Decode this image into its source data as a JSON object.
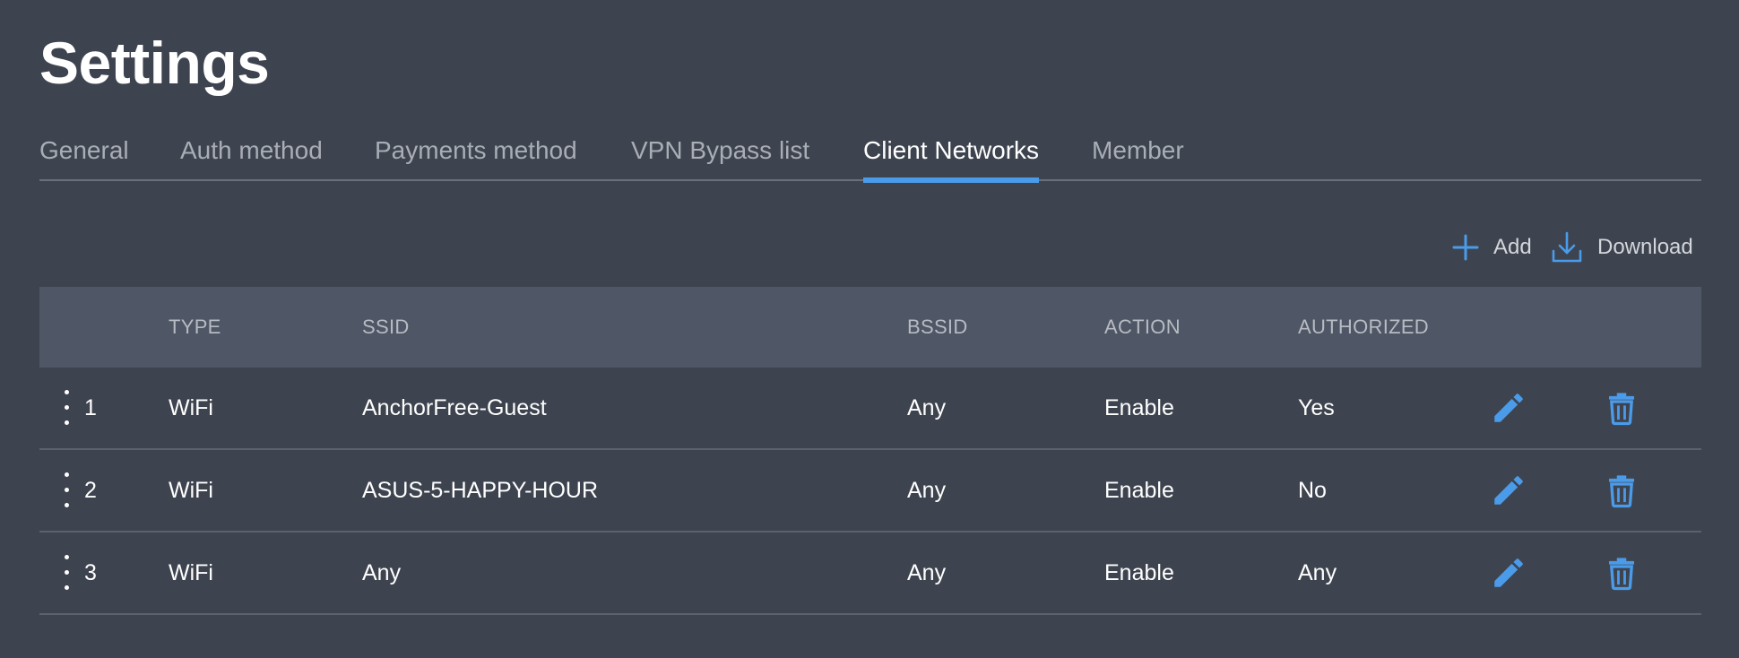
{
  "page": {
    "title": "Settings"
  },
  "tabs": [
    {
      "label": "General",
      "active": false
    },
    {
      "label": "Auth method",
      "active": false
    },
    {
      "label": "Payments method",
      "active": false
    },
    {
      "label": "VPN Bypass list",
      "active": false
    },
    {
      "label": "Client Networks",
      "active": true
    },
    {
      "label": "Member",
      "active": false
    }
  ],
  "toolbar": {
    "add_label": "Add",
    "add_icon": "plus-icon",
    "download_label": "Download",
    "download_icon": "download-icon"
  },
  "table": {
    "headers": {
      "type": "TYPE",
      "ssid": "SSID",
      "bssid": "BSSID",
      "action": "ACTION",
      "authorized": "AUTHORIZED"
    },
    "rows": [
      {
        "index": "1",
        "type": "WiFi",
        "ssid": "AnchorFree-Guest",
        "bssid": "Any",
        "action": "Enable",
        "authorized": "Yes"
      },
      {
        "index": "2",
        "type": "WiFi",
        "ssid": "ASUS-5-HAPPY-HOUR",
        "bssid": "Any",
        "action": "Enable",
        "authorized": "No"
      },
      {
        "index": "3",
        "type": "WiFi",
        "ssid": "Any",
        "bssid": "Any",
        "action": "Enable",
        "authorized": "Any"
      }
    ],
    "row_icons": {
      "drag": "drag-handle-icon",
      "edit": "pencil-icon",
      "delete": "trash-icon"
    }
  },
  "colors": {
    "background": "#3e444f",
    "header_background": "#4f5665",
    "accent": "#4a9bea",
    "muted_text": "#a9adb5"
  }
}
